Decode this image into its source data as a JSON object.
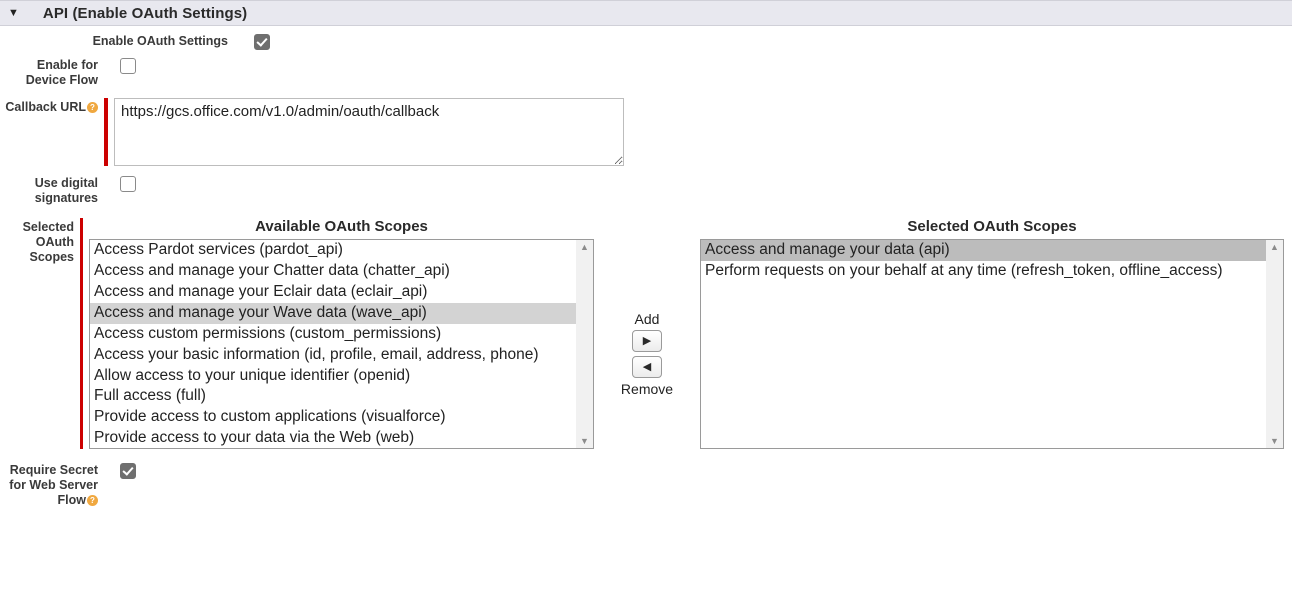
{
  "section": {
    "title": "API (Enable OAuth Settings)"
  },
  "fields": {
    "enable_oauth": {
      "label": "Enable OAuth Settings",
      "checked": true
    },
    "device_flow": {
      "label": "Enable for Device Flow",
      "checked": false
    },
    "callback": {
      "label": "Callback URL",
      "value": "https://gcs.office.com/v1.0/admin/oauth/callback"
    },
    "digital_sig": {
      "label": "Use digital signatures",
      "checked": false
    },
    "scopes": {
      "label": "Selected OAuth Scopes"
    },
    "require_secret": {
      "label": "Require Secret for Web Server Flow",
      "checked": true
    }
  },
  "scopes_picker": {
    "available_title": "Available OAuth Scopes",
    "selected_title": "Selected OAuth Scopes",
    "add_label": "Add",
    "remove_label": "Remove",
    "available": [
      {
        "text": "Access Pardot services (pardot_api)",
        "selected": false
      },
      {
        "text": "Access and manage your Chatter data (chatter_api)",
        "selected": false
      },
      {
        "text": "Access and manage your Eclair data (eclair_api)",
        "selected": false
      },
      {
        "text": "Access and manage your Wave data (wave_api)",
        "selected": true
      },
      {
        "text": "Access custom permissions (custom_permissions)",
        "selected": false
      },
      {
        "text": "Access your basic information (id, profile, email, address, phone)",
        "selected": false
      },
      {
        "text": "Allow access to your unique identifier (openid)",
        "selected": false
      },
      {
        "text": "Full access (full)",
        "selected": false
      },
      {
        "text": "Provide access to custom applications (visualforce)",
        "selected": false
      },
      {
        "text": "Provide access to your data via the Web (web)",
        "selected": false
      }
    ],
    "selected": [
      {
        "text": "Access and manage your data (api)",
        "selected": true
      },
      {
        "text": "Perform requests on your behalf at any time (refresh_token, offline_access)",
        "selected": false
      }
    ]
  }
}
